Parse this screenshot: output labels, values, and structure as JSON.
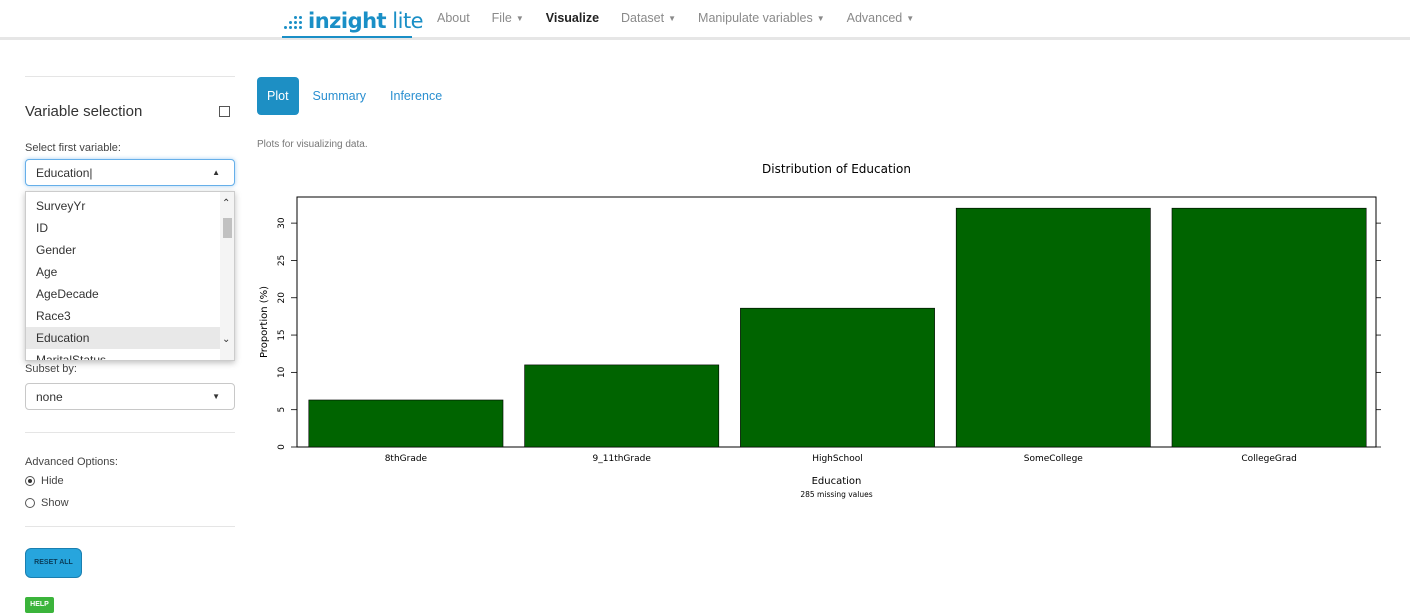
{
  "navbar": {
    "brand_main": "inzight",
    "brand_lite": " lite",
    "items": [
      {
        "label": "About",
        "caret": false,
        "active": false
      },
      {
        "label": "File",
        "caret": true,
        "active": false
      },
      {
        "label": "Visualize",
        "caret": false,
        "active": true
      },
      {
        "label": "Dataset",
        "caret": true,
        "active": false
      },
      {
        "label": "Manipulate variables",
        "caret": true,
        "active": false
      },
      {
        "label": "Advanced",
        "caret": true,
        "active": false
      }
    ]
  },
  "sidebar": {
    "title": "Variable selection",
    "first_var_label": "Select first variable:",
    "first_var_value": "Education",
    "dropdown_options": [
      "SurveyYr",
      "ID",
      "Gender",
      "Age",
      "AgeDecade",
      "Race3",
      "Education",
      "MaritalStatus"
    ],
    "dropdown_selected": "Education",
    "subset_label": "Subset by:",
    "subset_value": "none",
    "advanced_label": "Advanced Options:",
    "radio_hide": "Hide",
    "radio_show": "Show",
    "radio_selected": "Hide",
    "reset_label": "RESET ALL",
    "help_label": "HELP"
  },
  "main": {
    "tabs": [
      "Plot",
      "Summary",
      "Inference"
    ],
    "active_tab": "Plot",
    "description": "Plots for visualizing data."
  },
  "colors": {
    "brand": "#1a8fc6",
    "bar": "#006400",
    "tab_active": "#1d8fc4"
  },
  "chart_data": {
    "type": "bar",
    "title": "Distribution of Education",
    "xlabel": "Education",
    "ylabel": "Proportion (%)",
    "note": "285 missing values",
    "categories": [
      "8thGrade",
      "9_11thGrade",
      "HighSchool",
      "SomeCollege",
      "CollegeGrad"
    ],
    "values": [
      6.3,
      11.0,
      18.6,
      32.0,
      32.0
    ],
    "ylim": [
      0,
      33.5
    ],
    "yticks": [
      0,
      5,
      10,
      15,
      20,
      25,
      30
    ],
    "bar_color": "#006400",
    "grid": false
  }
}
